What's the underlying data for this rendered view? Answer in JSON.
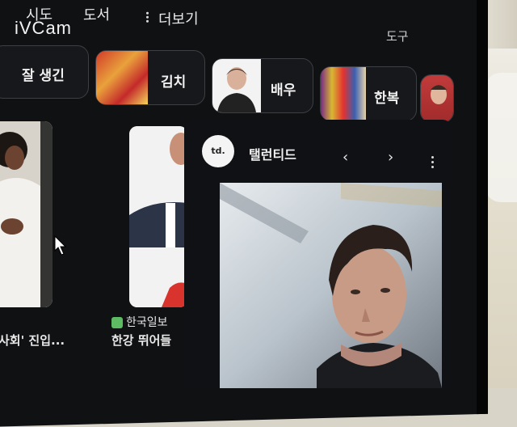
{
  "watermark": "iVCam",
  "tabs": [
    {
      "label": "시도"
    },
    {
      "label": "도서"
    },
    {
      "label": "더보기"
    }
  ],
  "tools_label": "도구",
  "chips": [
    {
      "label": "잘 생긴"
    },
    {
      "label": "김치"
    },
    {
      "label": "배우"
    },
    {
      "label": "한복"
    }
  ],
  "results": [
    {
      "title": "사회' 진입..."
    },
    {
      "source": "한국일보",
      "title": "한강 뛰어들"
    }
  ],
  "panel": {
    "logo_text": "td.",
    "site_name": "탤런티드",
    "prev": "‹",
    "next": "›"
  },
  "colors": {
    "background": "#101113",
    "chip_border": "#3d3f44",
    "text": "#f1f1f1"
  }
}
